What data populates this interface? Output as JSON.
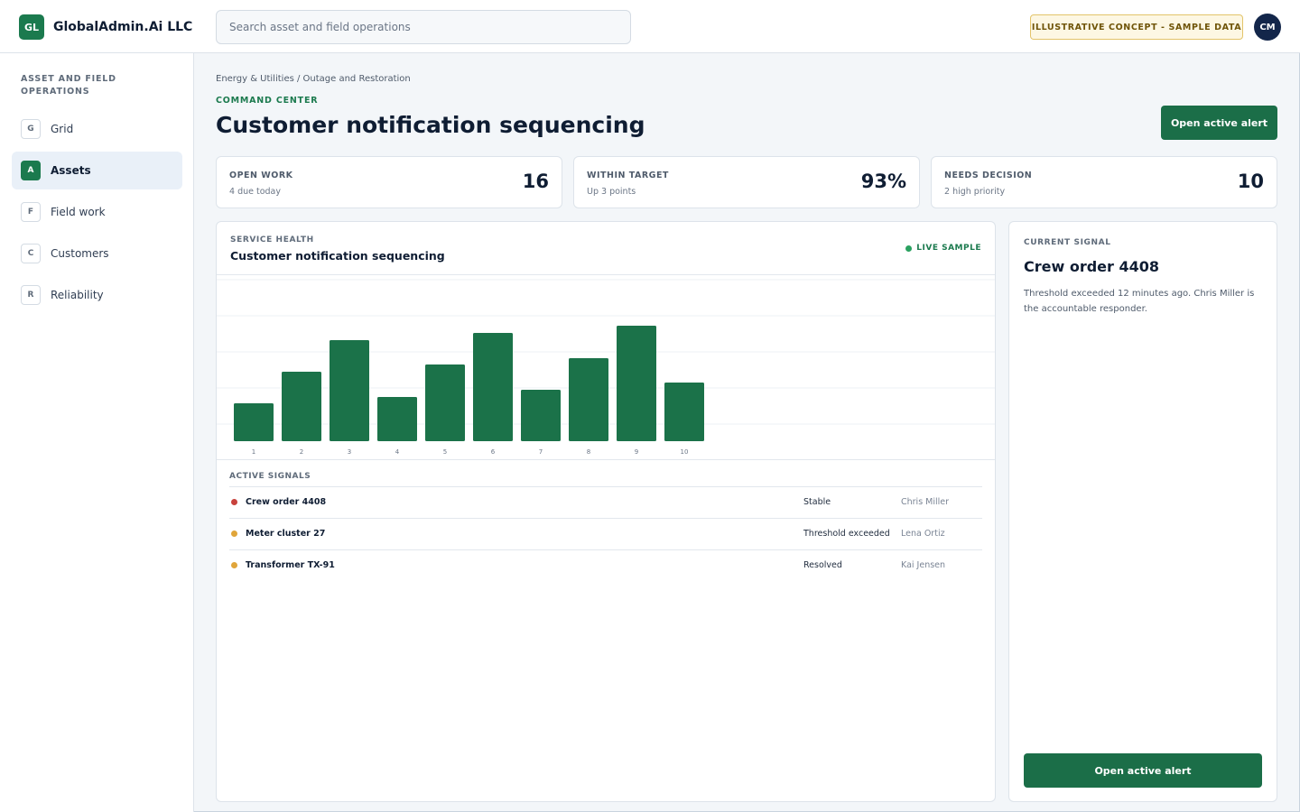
{
  "app": {
    "logo_text": "GL",
    "brand_name": "GlobalAdmin.Ai LLC"
  },
  "search": {
    "placeholder": "Search asset and field operations",
    "value": ""
  },
  "header": {
    "concept_badge": "ILLUSTRATIVE CONCEPT - SAMPLE DATA",
    "avatar_initials": "CM"
  },
  "sidebar": {
    "heading": "ASSET AND FIELD OPERATIONS",
    "items": [
      {
        "letter": "G",
        "label": "Grid",
        "active": false
      },
      {
        "letter": "A",
        "label": "Assets",
        "active": true
      },
      {
        "letter": "F",
        "label": "Field work",
        "active": false
      },
      {
        "letter": "C",
        "label": "Customers",
        "active": false
      },
      {
        "letter": "R",
        "label": "Reliability",
        "active": false
      }
    ]
  },
  "page": {
    "breadcrumb": "Energy & Utilities / Outage and Restoration",
    "eyebrow": "COMMAND CENTER",
    "title": "Customer notification sequencing",
    "primary_action": "Open active alert"
  },
  "kpis": [
    {
      "label": "OPEN WORK",
      "sub": "4 due today",
      "value": "16"
    },
    {
      "label": "WITHIN TARGET",
      "sub": "Up 3 points",
      "value": "93%"
    },
    {
      "label": "NEEDS DECISION",
      "sub": "2 high priority",
      "value": "10"
    }
  ],
  "panel": {
    "eyebrow": "SERVICE HEALTH",
    "title": "Customer notification sequencing",
    "live_label": "LIVE SAMPLE",
    "signals_heading": "ACTIVE SIGNALS",
    "signals": [
      {
        "name": "Crew order 4408",
        "status": "Stable",
        "owner": "Chris Miller",
        "dot_color": "#c8423c"
      },
      {
        "name": "Meter cluster 27",
        "status": "Threshold exceeded",
        "owner": "Lena Ortiz",
        "dot_color": "#e0a53a"
      },
      {
        "name": "Transformer TX-91",
        "status": "Resolved",
        "owner": "Kai Jensen",
        "dot_color": "#e0a53a"
      }
    ]
  },
  "chart_data": {
    "type": "bar",
    "categories": [
      "1",
      "2",
      "3",
      "4",
      "5",
      "6",
      "7",
      "8",
      "9",
      "10"
    ],
    "values": [
      42,
      77,
      112,
      49,
      85,
      120,
      57,
      92,
      128,
      65
    ],
    "ylim": [
      0,
      180
    ],
    "grid": true,
    "bar_color": "#1b7249",
    "title": "",
    "xlabel": "",
    "ylabel": ""
  },
  "current_signal": {
    "eyebrow": "CURRENT SIGNAL",
    "title": "Crew order 4408",
    "description": "Threshold exceeded 12 minutes ago. Chris Miller is the accountable responder.",
    "action": "Open active alert"
  },
  "colors": {
    "accent": "#1b6e48",
    "brand": "#1b7a4e",
    "avatar": "#13264a",
    "badge_border": "#e3c46a",
    "badge_bg": "#fdf7e3"
  }
}
